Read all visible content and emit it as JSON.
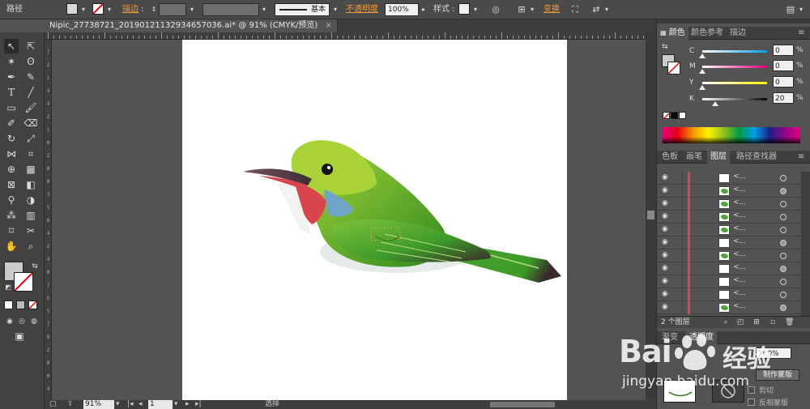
{
  "control_bar": {
    "path_label": "路径",
    "stroke_label": "描边",
    "stroke_style": "基本",
    "opacity_label": "不透明度",
    "opacity_value": "100%",
    "style_label": "样式",
    "transform_label": "变换"
  },
  "document": {
    "tab_title": "Nipic_27738721_20190121132934657036.ai* @ 91% (CMYK/预览)",
    "close_glyph": "×"
  },
  "rulers": {
    "vertical_numbers": [
      "7",
      "2",
      "1",
      "4",
      "4",
      "2",
      "1",
      "6",
      "2",
      "8",
      "8",
      "3",
      "5",
      "6",
      "4",
      "2",
      "4",
      "8",
      "7",
      "0",
      "5",
      "7",
      "9",
      "2",
      "8",
      "6",
      "4"
    ]
  },
  "status_bar": {
    "zoom": "91%",
    "page": "1",
    "state": "选择"
  },
  "color_panel": {
    "tabs": [
      "颜色",
      "颜色参考",
      "描边"
    ],
    "active_tab": "颜色",
    "channels": [
      {
        "label": "C",
        "value": "0",
        "level": 0,
        "gradient": [
          "#ffffff",
          "#00a0e9"
        ]
      },
      {
        "label": "M",
        "value": "0",
        "level": 0,
        "gradient": [
          "#ffffff",
          "#e4007f"
        ]
      },
      {
        "label": "Y",
        "value": "0",
        "level": 0,
        "gradient": [
          "#ffffff",
          "#fff100"
        ]
      },
      {
        "label": "K",
        "value": "20",
        "level": 0.2,
        "gradient": [
          "#ffffff",
          "#000000"
        ]
      }
    ],
    "percent_sign": "%",
    "fill_color": "#cccccc"
  },
  "layers_panel": {
    "tabs": [
      "色板",
      "画笔",
      "图层",
      "路径查找器"
    ],
    "active_tab": "图层",
    "row_name": "<...",
    "rows": [
      {
        "thumb": "blank",
        "target": "hollow"
      },
      {
        "thumb": "leaf",
        "target": "filled"
      },
      {
        "thumb": "leaf",
        "target": "hollow"
      },
      {
        "thumb": "leaf",
        "target": "hollow"
      },
      {
        "thumb": "leaf",
        "target": "hollow"
      },
      {
        "thumb": "blank",
        "target": "filled"
      },
      {
        "thumb": "leaf",
        "target": "hollow"
      },
      {
        "thumb": "blank",
        "target": "filled"
      },
      {
        "thumb": "blank",
        "target": "hollow"
      },
      {
        "thumb": "blank",
        "target": "hollow"
      },
      {
        "thumb": "leaf",
        "target": "filled"
      }
    ],
    "layer_color": "#e2434b",
    "footer_count": "2 个图层"
  },
  "transparency_panel": {
    "tab_label": "渐变",
    "tab_label2": "透明度",
    "opacity": "100%",
    "make_mask_label": "制作蒙版",
    "clip_label": "剪切",
    "invert_label": "反相蒙版"
  },
  "watermark": {
    "brand": "Bai",
    "brand_tail": "经验",
    "url": "jingyan.baidu.com"
  },
  "artwork": {
    "body_color_light": "#a8d43a",
    "body_color_dark": "#2f8a1e",
    "beak_color": "#3a2a33",
    "throat_color": "#d9454d",
    "breast_color": "#6fa6c8",
    "shadow_color": "#e4ebe8"
  }
}
